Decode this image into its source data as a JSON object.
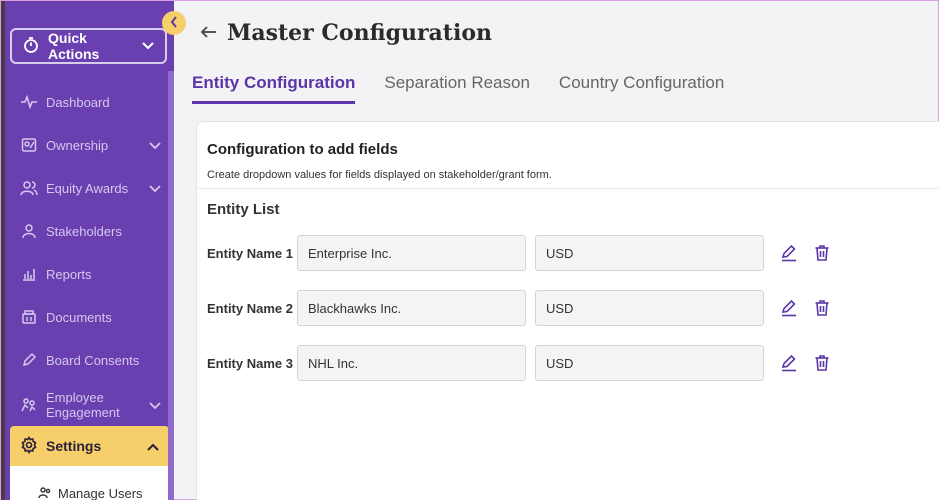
{
  "sidebar": {
    "quick_actions_label": "Quick Actions",
    "items": [
      {
        "label": "Dashboard",
        "icon": "pulse-icon"
      },
      {
        "label": "Ownership",
        "icon": "ownership-icon"
      },
      {
        "label": "Equity Awards",
        "icon": "users-icon"
      },
      {
        "label": "Stakeholders",
        "icon": "user-icon"
      },
      {
        "label": "Reports",
        "icon": "bar-chart-icon"
      },
      {
        "label": "Documents",
        "icon": "documents-icon"
      },
      {
        "label": "Board Consents",
        "icon": "pen-icon"
      },
      {
        "label": "Employee Engagement",
        "icon": "engagement-icon"
      }
    ],
    "settings_label": "Settings",
    "submenu_label": "Manage Users"
  },
  "page": {
    "title": "Master Configuration",
    "tabs": [
      {
        "label": "Entity Configuration"
      },
      {
        "label": "Separation Reason"
      },
      {
        "label": "Country Configuration"
      }
    ]
  },
  "card": {
    "title": "Configuration to add fields",
    "subtitle": "Create dropdown values for fields displayed on stakeholder/grant form.",
    "section_title": "Entity List",
    "entities": [
      {
        "label": "Entity Name 1",
        "name": "Enterprise Inc.",
        "currency": "USD"
      },
      {
        "label": "Entity Name 2",
        "name": "Blackhawks Inc.",
        "currency": "USD"
      },
      {
        "label": "Entity Name 3",
        "name": "NHL Inc.",
        "currency": "USD"
      }
    ]
  },
  "colors": {
    "sidebar": "#6a3fb0",
    "accent": "#5a36a8",
    "highlight": "#f7cf6a"
  }
}
